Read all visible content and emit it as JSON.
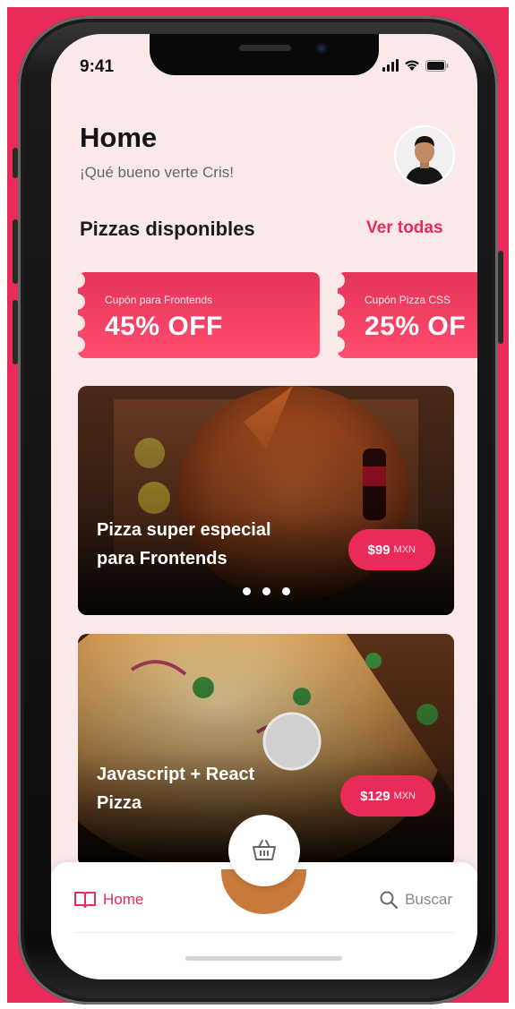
{
  "colors": {
    "brand": "#ea2a58"
  },
  "status": {
    "time": "9:41"
  },
  "header": {
    "title": "Home",
    "subtitle": "¡Qué bueno verte Cris!"
  },
  "section": {
    "title": "Pizzas disponibles",
    "see_all": "Ver todas"
  },
  "coupons": [
    {
      "label": "Cupón para Frontends",
      "discount": "45% OFF"
    },
    {
      "label": "Cupón Pizza CSS",
      "discount": "25% OF"
    }
  ],
  "pizzas": [
    {
      "name_line1": "Pizza super especial",
      "name_line2": "para Frontends",
      "price": "$99",
      "currency": "MXN"
    },
    {
      "name_line1": "Javascript + React",
      "name_line2": "Pizza",
      "price": "$129",
      "currency": "MXN"
    }
  ],
  "carousel_dots": 3,
  "tabbar": {
    "home_label": "Home",
    "search_label": "Buscar"
  },
  "icons": {
    "home_tab": "book-open-icon",
    "search_tab": "search-icon",
    "cart": "basket-icon",
    "signal": "signal-icon",
    "wifi": "wifi-icon",
    "battery": "battery-icon"
  }
}
